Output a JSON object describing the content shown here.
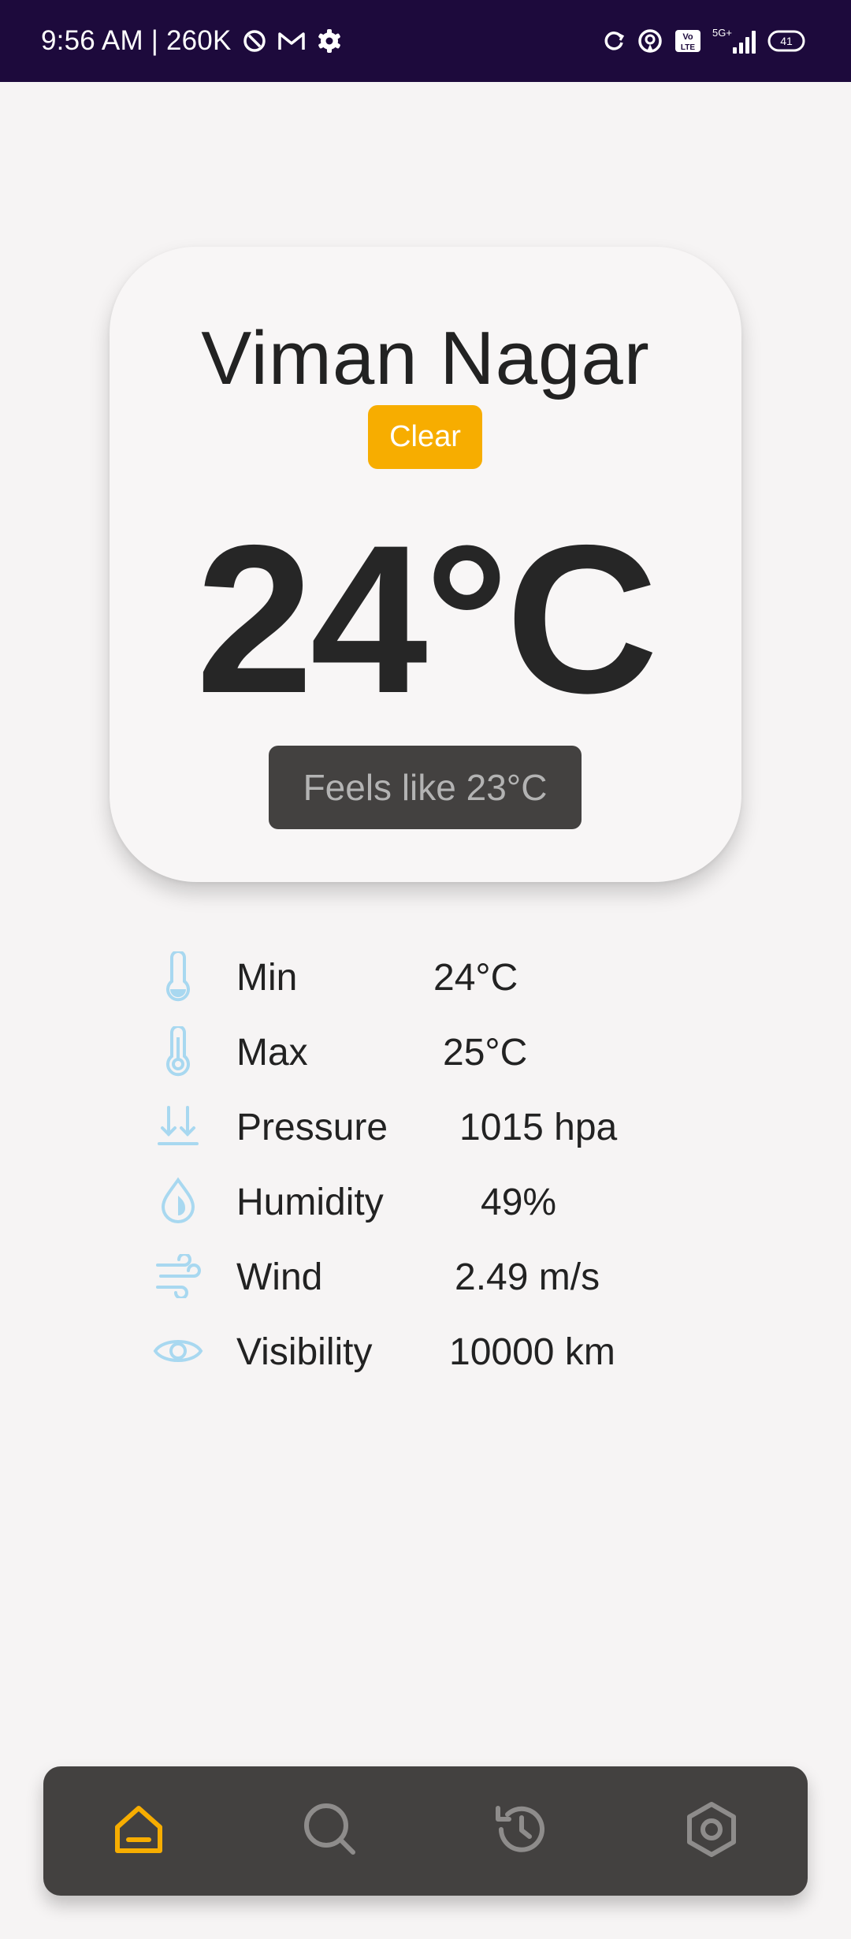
{
  "status_bar": {
    "time": "9:56 AM | 260K",
    "battery": "41",
    "network": "5G+",
    "icons": [
      "do-not-disturb-icon",
      "gmail-icon",
      "settings-gear-icon",
      "sync-icon",
      "hotspot-icon",
      "volte-icon",
      "signal-icon",
      "battery-icon"
    ]
  },
  "weather": {
    "city": "Viman Nagar",
    "condition": "Clear",
    "temperature": "24°C",
    "feels_like": "Feels like 23°C"
  },
  "details": [
    {
      "icon": "thermometer-low-icon",
      "label": "Min",
      "value": "24°C"
    },
    {
      "icon": "thermometer-high-icon",
      "label": "Max",
      "value": "25°C"
    },
    {
      "icon": "pressure-arrows-icon",
      "label": "Pressure",
      "value": "1015 hpa"
    },
    {
      "icon": "humidity-drop-icon",
      "label": "Humidity",
      "value": "49%"
    },
    {
      "icon": "wind-icon",
      "label": "Wind",
      "value": "2.49 m/s"
    },
    {
      "icon": "visibility-eye-icon",
      "label": "Visibility",
      "value": "10000 km"
    }
  ],
  "nav": {
    "items": [
      {
        "icon": "home-icon",
        "active": true
      },
      {
        "icon": "search-icon",
        "active": false
      },
      {
        "icon": "history-icon",
        "active": false
      },
      {
        "icon": "settings-icon",
        "active": false
      }
    ]
  },
  "colors": {
    "status_bar_bg": "#1d0a3c",
    "accent": "#f7ad00",
    "detail_icon": "#a8d8f0",
    "nav_bg": "#434140",
    "nav_icon_inactive": "#8e8c8b"
  }
}
